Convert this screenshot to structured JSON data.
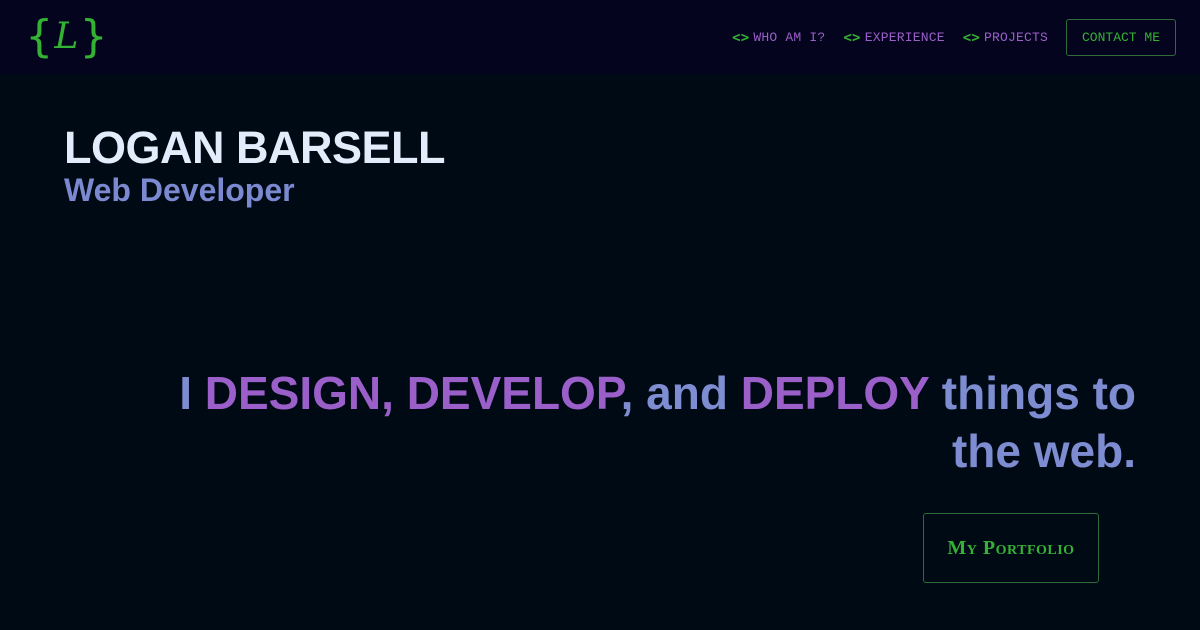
{
  "header": {
    "logo": {
      "open_brace": "{",
      "letter": "L",
      "close_brace": "}"
    },
    "nav": {
      "icon": "<>",
      "items": [
        {
          "label": "WHO AM I?"
        },
        {
          "label": "EXPERIENCE"
        },
        {
          "label": "PROJECTS"
        }
      ],
      "contact_label": "CONTACT ME"
    }
  },
  "hero": {
    "name": "LOGAN BARSELL",
    "role": "Web Developer",
    "tagline": {
      "part1": "I ",
      "design": "DESIGN",
      "comma1": ", ",
      "develop": "DEVELOP",
      "part2": ", and ",
      "deploy": "DEPLOY",
      "part3": " things to the web."
    },
    "portfolio_label": "My Portfolio"
  },
  "colors": {
    "background": "#000a14",
    "navbar": "#05041e",
    "accent_green": "#34b233",
    "accent_purple": "#9b5fc9",
    "text_blue": "#7e8dd1",
    "text_light": "#e3ecfb"
  }
}
